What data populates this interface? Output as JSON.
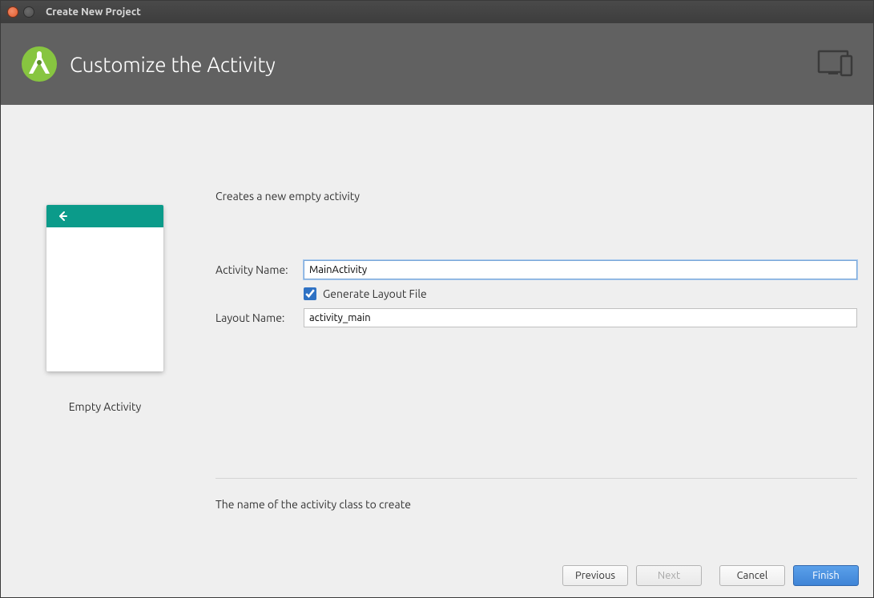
{
  "window": {
    "title": "Create New Project"
  },
  "header": {
    "title": "Customize the Activity"
  },
  "description": "Creates a new empty activity",
  "preview": {
    "caption": "Empty Activity"
  },
  "form": {
    "activity_name_label": "Activity Name:",
    "activity_name_value": "MainActivity",
    "generate_layout_label": "Generate Layout File",
    "generate_layout_checked": true,
    "layout_name_label": "Layout Name:",
    "layout_name_value": "activity_main"
  },
  "hint": "The name of the activity class to create",
  "buttons": {
    "previous": "Previous",
    "next": "Next",
    "cancel": "Cancel",
    "finish": "Finish"
  }
}
